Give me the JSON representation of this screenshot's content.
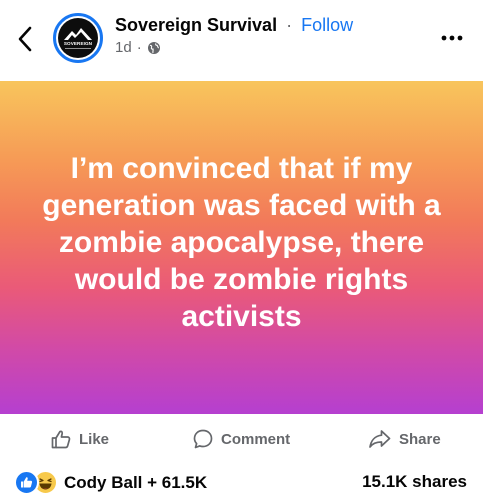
{
  "header": {
    "page_name": "Sovereign Survival",
    "separator": "·",
    "follow_label": "Follow",
    "timestamp": "1d",
    "meta_separator": "·",
    "audience_icon": "globe-icon",
    "avatar_text": "SOVEREIGN",
    "back_icon": "chevron-left-icon",
    "more_icon": "more-horizontal-icon"
  },
  "post": {
    "text": "I’m convinced that if my generation was faced with a zombie apocalypse, there would be zombie rights activists",
    "gradient_colors": [
      "#f8c55c",
      "#f69a56",
      "#f27a5a",
      "#ea5a78",
      "#d24aa6",
      "#b53fd0"
    ]
  },
  "actions": {
    "like_label": "Like",
    "comment_label": "Comment",
    "share_label": "Share"
  },
  "footer": {
    "reactions": [
      "like",
      "haha"
    ],
    "reactors_text": "Cody Ball + 61.5K",
    "shares_text": "15.1K shares"
  },
  "colors": {
    "accent": "#1877f2",
    "secondary_text": "#65676b",
    "primary_text": "#050505"
  }
}
